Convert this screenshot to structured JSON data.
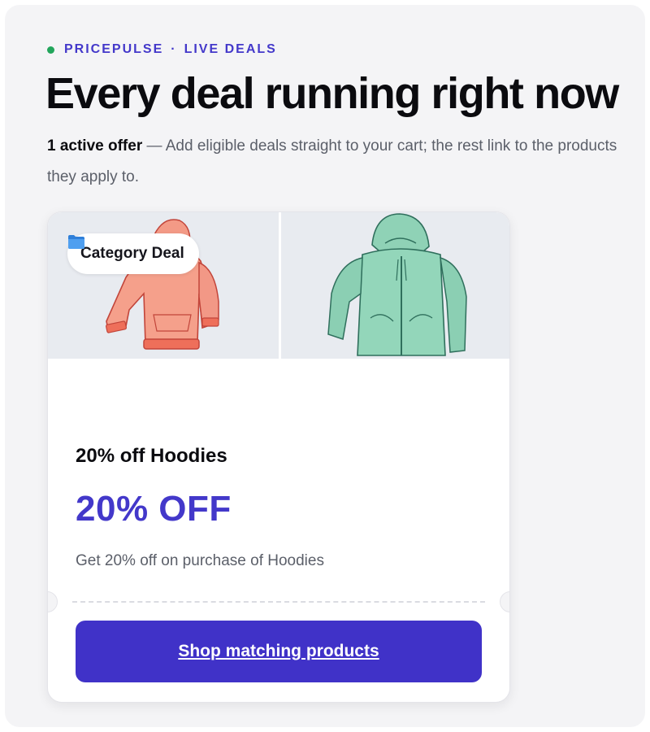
{
  "header": {
    "brand": "PRICEPULSE",
    "separator": "·",
    "section": "LIVE DEALS",
    "status_color": "#22a55b",
    "title": "Every deal running right now",
    "offer_count": "1 active offer",
    "description": " — Add eligible deals straight to your cart; the rest link to the products they apply to."
  },
  "deal": {
    "badge_icon": "folder-icon",
    "badge_label": "Category Deal",
    "images": [
      "coral-hoodie",
      "mint-zip-hoodie"
    ],
    "title": "20% off Hoodies",
    "amount": "20% OFF",
    "description": "Get 20% off on purchase of Hoodies",
    "cta_label": "Shop matching products",
    "accent_color": "#4032c8"
  }
}
